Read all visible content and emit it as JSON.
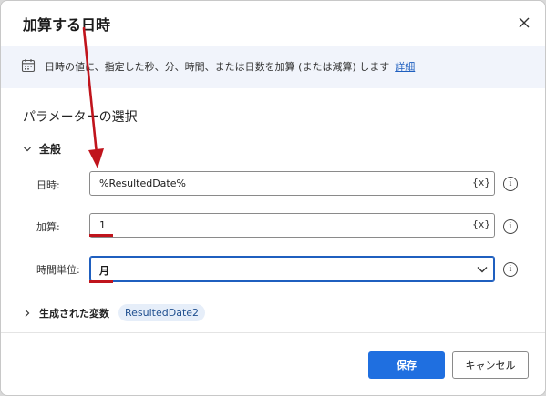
{
  "dialog": {
    "title": "加算する日時",
    "close_icon": "close-icon"
  },
  "info": {
    "icon": "calendar-icon",
    "text": "日時の値に、指定した秒、分、時間、または日数を加算 (または減算) します",
    "link": "詳細"
  },
  "params": {
    "section_title": "パラメーターの選択",
    "group_label": "全般",
    "fields": [
      {
        "label": "日時:",
        "value": "%ResultedDate%",
        "suffix": "{x}"
      },
      {
        "label": "加算:",
        "value": "1",
        "suffix": "{x}"
      },
      {
        "label": "時間単位:",
        "value": "月"
      }
    ],
    "help_glyph": "i"
  },
  "output": {
    "label": "生成された変数",
    "variable": "ResultedDate2"
  },
  "footer": {
    "save_label": "保存",
    "cancel_label": "キャンセル"
  },
  "colors": {
    "accent": "#1f6fe0",
    "annotation": "#c0141c",
    "info_bg": "#f1f4fb"
  }
}
